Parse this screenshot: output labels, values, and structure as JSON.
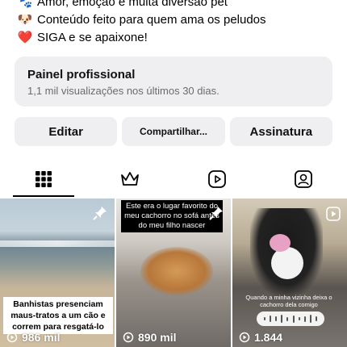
{
  "bio": {
    "lines": [
      {
        "icon": "paw-icon",
        "emoji": "🐾",
        "text": "Amor, emoção e muita diversão pet"
      },
      {
        "icon": "dog-face-icon",
        "emoji": "🐶",
        "text": "Conteúdo feito para quem ama os peludos"
      },
      {
        "icon": "heart-icon",
        "emoji": "❤️",
        "text": "SIGA e se apaixone!"
      }
    ]
  },
  "panel": {
    "title": "Painel profissional",
    "subtitle": "1,1 mil visualizações nos últimos 30 dias."
  },
  "buttons": {
    "edit": "Editar",
    "share": "Compartilhar...",
    "subscription": "Assinatura"
  },
  "tabs": [
    {
      "name": "grid",
      "icon": "grid-icon",
      "active": true
    },
    {
      "name": "subscriber",
      "icon": "crown-icon",
      "active": false
    },
    {
      "name": "reels",
      "icon": "reels-icon",
      "active": false
    },
    {
      "name": "tagged",
      "icon": "tagged-person-icon",
      "active": false
    }
  ],
  "posts": [
    {
      "caption": "Banhistas presenciam maus-tratos a um cão e correm para resgatá-lo",
      "views": "986 mil",
      "pinned": true
    },
    {
      "caption": "Este era o lugar favorito do meu cachorro no sofá antes do meu filho nascer",
      "views": "890 mil",
      "pinned": true
    },
    {
      "caption": "Quando a minha vizinha deixa o cachorro dela comigo",
      "views": "1.844",
      "pinned": false
    }
  ],
  "colors": {
    "button_bg": "#efeff1",
    "panel_bg": "#efeff1",
    "muted_text": "#6b6b6b"
  }
}
